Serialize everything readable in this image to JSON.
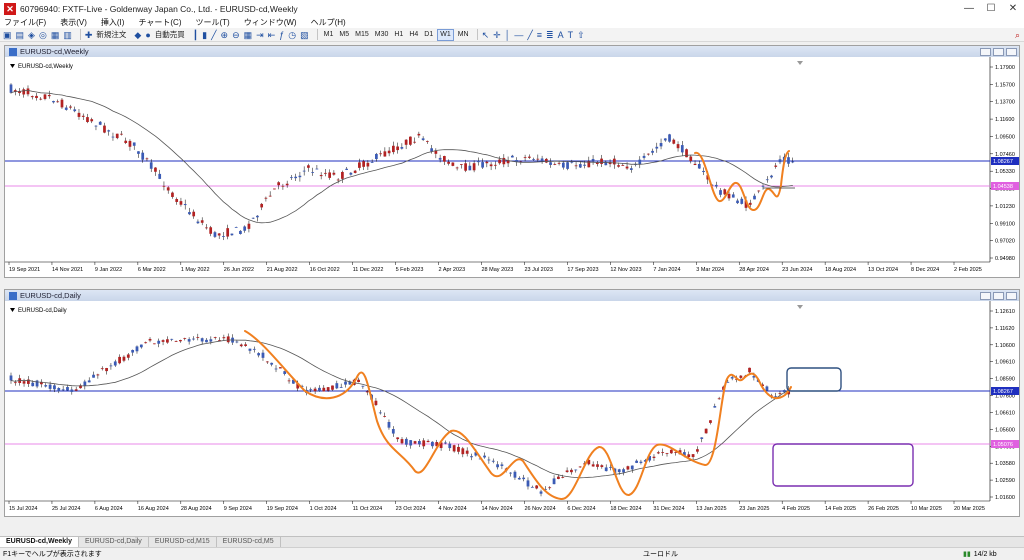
{
  "window": {
    "title": "60796940: FXTF-Live - Goldenway Japan Co., Ltd. - EURUSD-cd,Weekly",
    "icon": "app-icon"
  },
  "menu": [
    "ファイル(F)",
    "表示(V)",
    "挿入(I)",
    "チャート(C)",
    "ツール(T)",
    "ウィンドウ(W)",
    "ヘルプ(H)"
  ],
  "toolbar": {
    "new_order": "新規注文",
    "auto_trading": "自動売買",
    "timeframes": [
      "M1",
      "M5",
      "M15",
      "M30",
      "H1",
      "H4",
      "D1",
      "W1",
      "MN"
    ],
    "active_timeframe": "W1"
  },
  "weekly_chart": {
    "window_title": "EURUSD-cd,Weekly",
    "symbol_label": "EURUSD-cd,Weekly",
    "price_labels": [
      "1.17900",
      "1.15700",
      "1.13700",
      "1.11600",
      "1.09500",
      "1.07460",
      "1.05330",
      "1.03320",
      "1.01230",
      "0.99100",
      "0.97020",
      "0.94980"
    ],
    "current_price": "1.08267",
    "pink_price": "1.04538",
    "date_labels": [
      "19 Sep 2021",
      "14 Nov 2021",
      "9 Jan 2022",
      "6 Mar 2022",
      "1 May 2022",
      "26 Jun 2022",
      "21 Aug 2022",
      "16 Oct 2022",
      "11 Dec 2022",
      "5 Feb 2023",
      "2 Apr 2023",
      "28 May 2023",
      "23 Jul 2023",
      "17 Sep 2023",
      "12 Nov 2023",
      "7 Jan 2024",
      "3 Mar 2024",
      "28 Apr 2024",
      "23 Jun 2024",
      "18 Aug 2024",
      "13 Oct 2024",
      "8 Dec 2024",
      "2 Feb 2025"
    ]
  },
  "daily_chart": {
    "window_title": "EURUSD-cd,Daily",
    "symbol_label": "EURUSD-cd,Daily",
    "price_labels": [
      "1.12610",
      "1.11620",
      "1.10600",
      "1.09610",
      "1.08590",
      "1.07600",
      "1.06610",
      "1.05600",
      "1.04600",
      "1.03580",
      "1.02590",
      "1.01600"
    ],
    "current_price": "1.08267",
    "pink_price": "1.05076",
    "date_labels": [
      "15 Jul 2024",
      "25 Jul 2024",
      "6 Aug 2024",
      "16 Aug 2024",
      "28 Aug 2024",
      "9 Sep 2024",
      "19 Sep 2024",
      "1 Oct 2024",
      "11 Oct 2024",
      "23 Oct 2024",
      "4 Nov 2024",
      "14 Nov 2024",
      "26 Nov 2024",
      "6 Dec 2024",
      "18 Dec 2024",
      "31 Dec 2024",
      "13 Jan 2025",
      "23 Jan 2025",
      "4 Feb 2025",
      "14 Feb 2025",
      "26 Feb 2025",
      "10 Mar 2025",
      "20 Mar 2025"
    ]
  },
  "tabs": [
    "EURUSD-cd,Weekly",
    "EURUSD-cd,Daily",
    "EURUSD-cd,M15",
    "EURUSD-cd,M5"
  ],
  "active_tab": "EURUSD-cd,Weekly",
  "status": {
    "help": "F1キーでヘルプが表示されます",
    "profile": "ユーロドル",
    "traffic": "14/2 kb"
  },
  "colors": {
    "bull": "#b22222",
    "bear": "#3b5bb5",
    "current_line": "#1f2fbf",
    "pink_line": "#e060e0",
    "ma": "#555555",
    "wave": "#f08020",
    "box_blue": "#2f5080",
    "box_purple": "#7a2fb0"
  }
}
